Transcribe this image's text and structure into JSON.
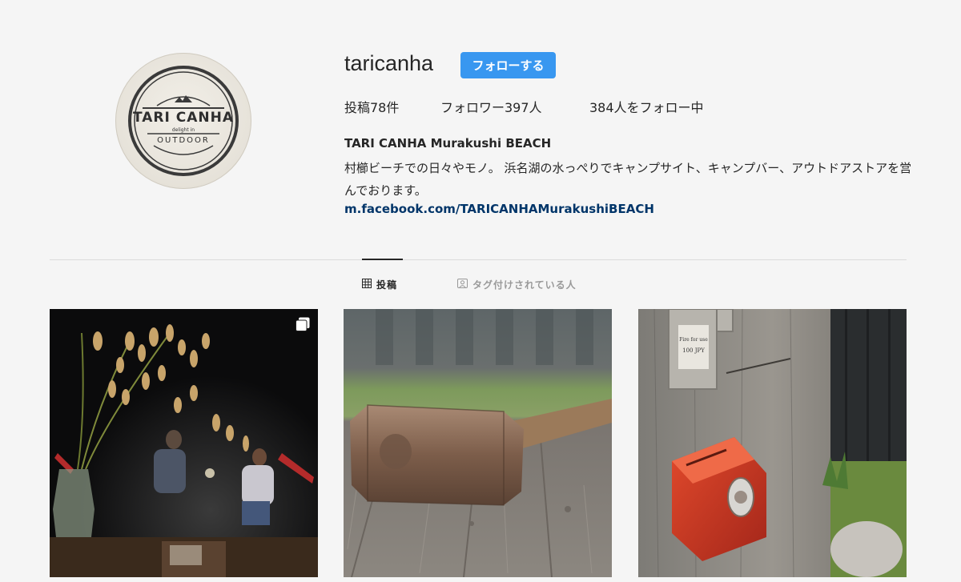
{
  "profile": {
    "username": "taricanha",
    "follow_label": "フォローする",
    "avatar_logo": {
      "main": "TARI CANHA",
      "tagline": "delight in",
      "sub": "OUTDOOR"
    },
    "stats": {
      "posts": "投稿78件",
      "followers": "フォロワー397人",
      "following": "384人をフォロー中"
    },
    "bio_name": "TARI CANHA Murakushi BEACH",
    "bio_text": "村櫛ビーチでの日々やモノ。 浜名湖の水っぺりでキャンプサイト、キャンプバー、アウトドアストアを営んでおります。",
    "bio_link": "m.facebook.com/TARICANHAMurakushiBEACH"
  },
  "tabs": {
    "posts": "投稿",
    "tagged": "タグ付けされている人"
  },
  "posts": [
    {
      "icon": "multi-image-icon"
    },
    {},
    {
      "sign_line1": "Fire for use",
      "sign_line2": "100 JPY"
    }
  ],
  "colors": {
    "follow_button": "#3897f0",
    "link": "#003569",
    "background": "#f5f5f5"
  }
}
